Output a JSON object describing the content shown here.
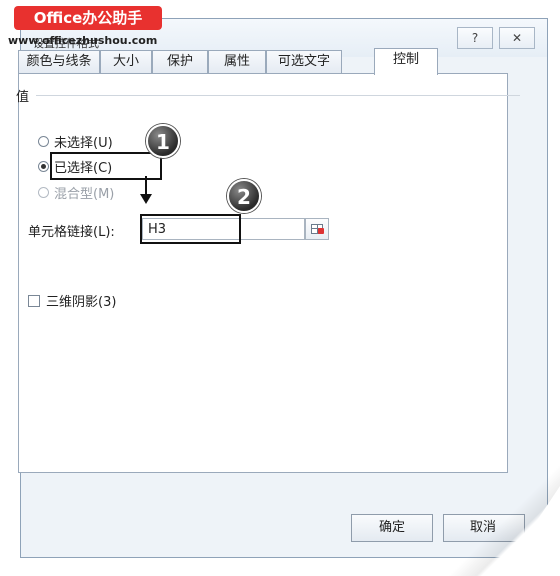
{
  "watermark": {
    "logo_text": "Office办公助手",
    "url_text": "www.officezhushou.com"
  },
  "dialog": {
    "title": "设置控件格式",
    "help_label": "?",
    "close_label": "✕"
  },
  "tabs": [
    {
      "label": "颜色与线条"
    },
    {
      "label": "大小"
    },
    {
      "label": "保护"
    },
    {
      "label": "属性"
    },
    {
      "label": "可选文字"
    },
    {
      "label": "控制"
    }
  ],
  "value_group": {
    "label": "值",
    "options": [
      {
        "label": "未选择(U)",
        "checked": false,
        "disabled": false
      },
      {
        "label": "已选择(C)",
        "checked": true,
        "disabled": false
      },
      {
        "label": "混合型(M)",
        "checked": false,
        "disabled": true
      }
    ]
  },
  "cell_link": {
    "label": "单元格链接(L):",
    "value": "H3"
  },
  "shading": {
    "label": "三维阴影(3)",
    "checked": false
  },
  "annotations": {
    "step1": "1",
    "step2": "2"
  },
  "buttons": {
    "ok": "确定",
    "cancel": "取消"
  },
  "colors": {
    "accent_red": "#e8312f",
    "dialog_bg": "#eef3f8"
  }
}
